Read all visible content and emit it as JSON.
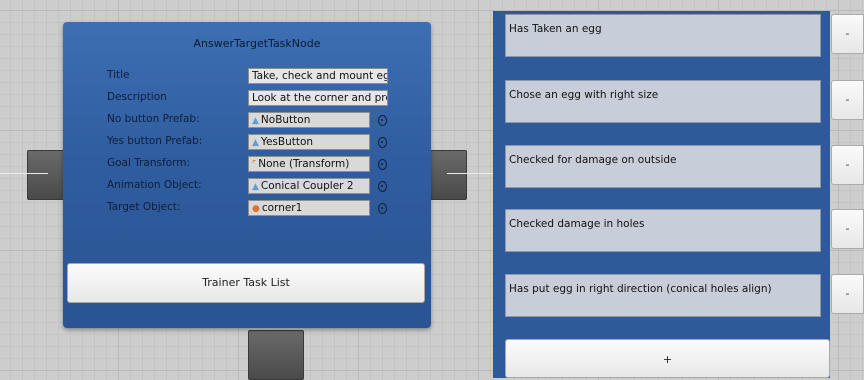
{
  "node": {
    "title": "AnswerTargetTaskNode",
    "props": [
      {
        "label": "Title",
        "value": "Take, check and mount egg",
        "kind": "text"
      },
      {
        "label": "Description",
        "value": "Look at the corner and pre:",
        "kind": "text"
      },
      {
        "label": "No button Prefab:",
        "value": "NoButton",
        "kind": "object",
        "icon": "prefab-icon",
        "icon_color": "#5a9fd6"
      },
      {
        "label": "Yes button Prefab:",
        "value": "YesButton",
        "kind": "object",
        "icon": "prefab-icon",
        "icon_color": "#5a9fd6"
      },
      {
        "label": "Goal Transform:",
        "value": "None (Transform)",
        "kind": "object",
        "icon": "transform-icon",
        "icon_color": "#d07c2e"
      },
      {
        "label": "Animation Object:",
        "value": "Conical Coupler 2",
        "kind": "object",
        "icon": "prefab-icon",
        "icon_color": "#5a9fd6"
      },
      {
        "label": "Target Object:",
        "value": "corner1",
        "kind": "object",
        "icon": "gameobject-icon",
        "icon_color": "#e0732c"
      }
    ],
    "trainer_button": "Trainer Task List"
  },
  "task_list": {
    "items": [
      {
        "text": "Has Taken an egg",
        "remove": "-"
      },
      {
        "text": "Chose an egg with right size",
        "remove": "-"
      },
      {
        "text": "Checked for damage on outside",
        "remove": "-"
      },
      {
        "text": "Checked damage in holes",
        "remove": "-"
      },
      {
        "text": "Has put egg in right direction (conical holes align)",
        "remove": "-"
      }
    ],
    "add_button": "+"
  },
  "colors": {
    "node_blue": "#2f5d9f",
    "grid_bg": "#cdcdcd",
    "item_bg": "#c8ced9"
  }
}
